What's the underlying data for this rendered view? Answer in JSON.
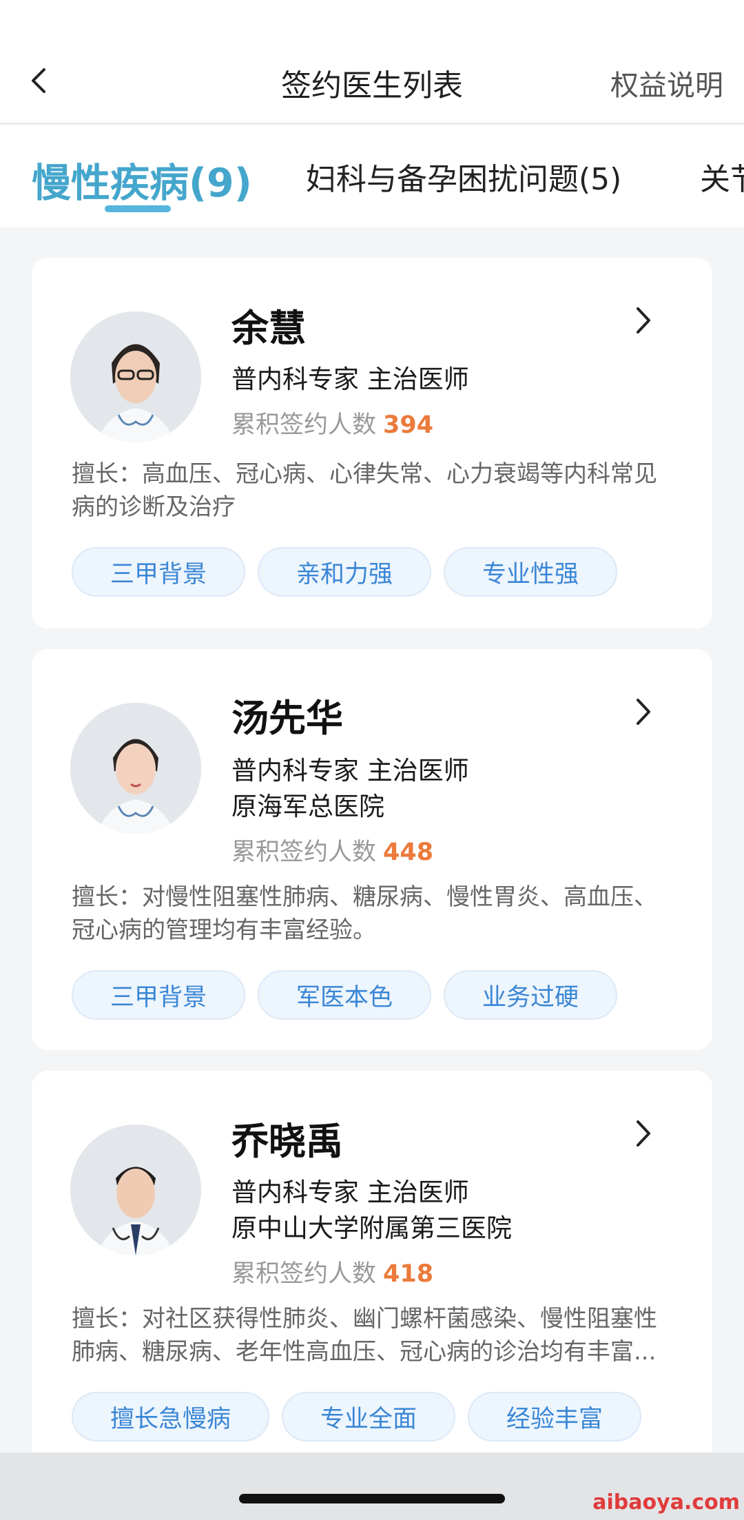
{
  "nav": {
    "title": "签约医生列表",
    "right_label": "权益说明",
    "back_icon": "chevron-left-icon"
  },
  "tabs": [
    {
      "label": "慢性疾病(9)",
      "active": true
    },
    {
      "label": "妇科与备孕困扰问题(5)",
      "active": false
    },
    {
      "label": "关节",
      "active": false
    }
  ],
  "doctors": [
    {
      "name": "余慧",
      "title": "普内科专家  主治医师",
      "hospital": "",
      "count_label": "累积签约人数",
      "count": "394",
      "specialty": "擅长：高血压、冠心病、心律失常、心力衰竭等内科常见病的诊断及治疗",
      "tags": [
        "三甲背景",
        "亲和力强",
        "专业性强"
      ]
    },
    {
      "name": "汤先华",
      "title": "普内科专家  主治医师",
      "hospital": "原海军总医院",
      "count_label": "累积签约人数",
      "count": "448",
      "specialty": "擅长：对慢性阻塞性肺病、糖尿病、慢性胃炎、高血压、冠心病的管理均有丰富经验。",
      "tags": [
        "三甲背景",
        "军医本色",
        "业务过硬"
      ]
    },
    {
      "name": "乔晓禹",
      "title": "普内科专家  主治医师",
      "hospital": "原中山大学附属第三医院",
      "count_label": "累积签约人数",
      "count": "418",
      "specialty": "擅长：对社区获得性肺炎、幽门螺杆菌感染、慢性阻塞性肺病、糖尿病、老年性高血压、冠心病的诊治均有丰富...",
      "tags": [
        "擅长急慢病",
        "专业全面",
        "经验丰富"
      ]
    }
  ],
  "watermark": "aibaoya.com",
  "colors": {
    "accent": "#45a6cc",
    "count": "#ec7a3a",
    "tag_text": "#3a86d6",
    "tag_bg": "#edf5fd"
  }
}
